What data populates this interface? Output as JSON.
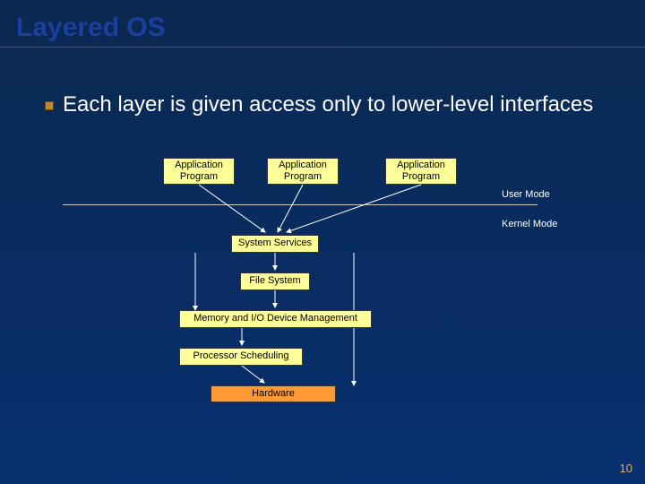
{
  "title": "Layered OS",
  "bullet": "Each layer is given access only to lower-level interfaces",
  "apps": {
    "app1": "Application\nProgram",
    "app2": "Application\nProgram",
    "app3": "Application\nProgram"
  },
  "labels": {
    "user_mode": "User Mode",
    "kernel_mode": "Kernel Mode"
  },
  "layers": {
    "system_services": "System Services",
    "file_system": "File System",
    "memory_io": "Memory and I/O Device Management",
    "processor": "Processor Scheduling",
    "hardware": "Hardware"
  },
  "slide_number": "10"
}
